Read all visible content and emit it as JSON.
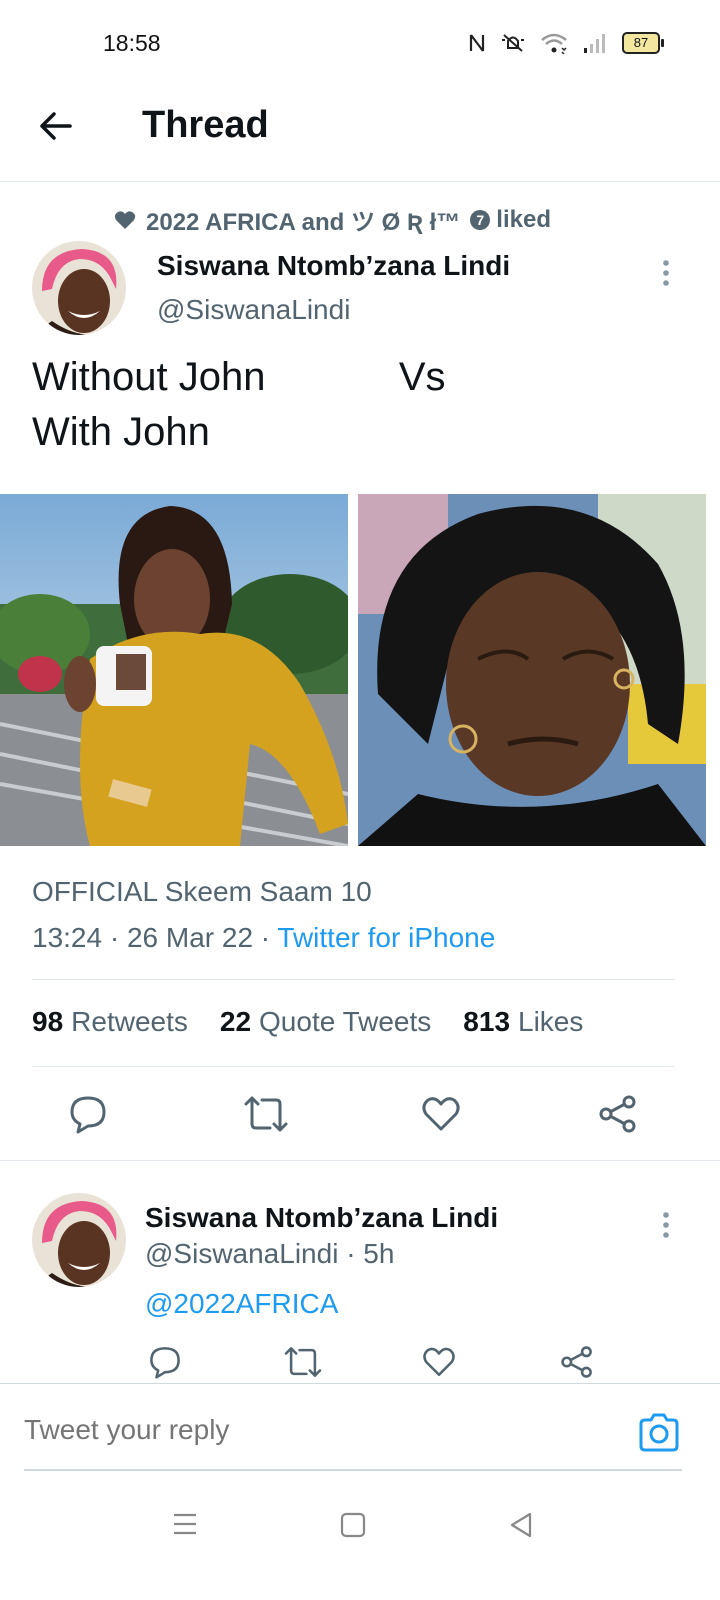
{
  "status": {
    "time": "18:58",
    "battery": "87"
  },
  "header": {
    "title": "Thread"
  },
  "tweet": {
    "social_context": "2022 AFRICA and ツ Ø Ʀ ł™",
    "social_count": "7",
    "social_suffix": "liked",
    "author_name": "Siswana Ntomb’zana Lindi",
    "author_handle": "@SiswanaLindi",
    "text": "Without John            Vs\nWith John",
    "source_title": "OFFICIAL Skeem Saam 10",
    "timestamp": "13:24 · 26 Mar 22 · ",
    "client": "Twitter for iPhone",
    "retweets_count": "98",
    "retweets_label": "Retweets",
    "quotes_count": "22",
    "quotes_label": "Quote Tweets",
    "likes_count": "813",
    "likes_label": "Likes"
  },
  "reply": {
    "author_name": "Siswana Ntomb’zana Lindi",
    "author_handle": "@SiswanaLindi · 5h",
    "text": "@2022AFRICA"
  },
  "composer": {
    "placeholder": "Tweet your reply"
  },
  "colors": {
    "accent": "#1d9bf0",
    "text": "#0f1419",
    "muted": "#536471"
  },
  "icons": [
    "back-arrow-icon",
    "heart-icon",
    "more-icon",
    "reply-icon",
    "retweet-icon",
    "like-icon",
    "share-icon",
    "camera-icon",
    "menu-icon",
    "home-square-icon",
    "back-triangle-icon"
  ]
}
